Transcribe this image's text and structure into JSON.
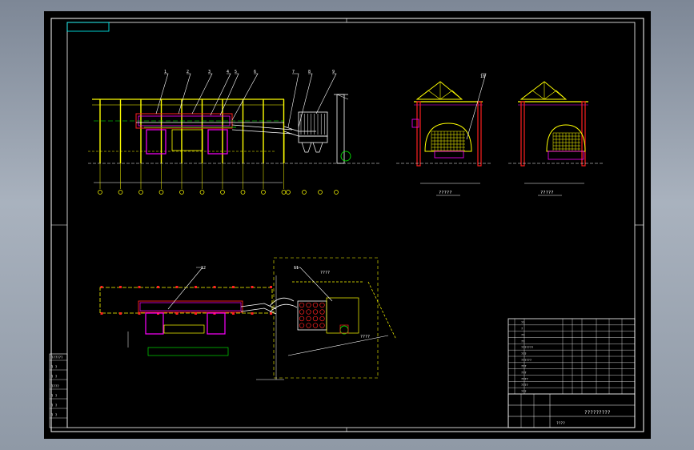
{
  "drawing": {
    "colors": {
      "background": "#000000",
      "frame": "#ffffff",
      "yellow": "#ffff00",
      "red": "#ff2020",
      "magenta": "#ff00ff",
      "green": "#00ff00",
      "cyan": "#00ffff",
      "white": "#ffffff"
    },
    "view_captions": {
      "section_a": "?????",
      "section_b": "?????",
      "plan_note_1": "????",
      "plan_note_2": "????"
    },
    "leader_numbers": [
      "1",
      "2",
      "3",
      "4",
      "5",
      "6",
      "7",
      "8",
      "9",
      "10",
      "11",
      "12"
    ],
    "title_block": {
      "title": "?????????",
      "company_row": "????",
      "rows": [
        "??",
        "?",
        "??",
        "??",
        "???????",
        "???",
        "??????",
        "???",
        "???",
        "????",
        "????",
        "???"
      ]
    },
    "side_table": {
      "rows": [
        "??????",
        "? ?",
        "? ?",
        "????",
        "? ?",
        "? ?",
        "? ?"
      ]
    }
  }
}
